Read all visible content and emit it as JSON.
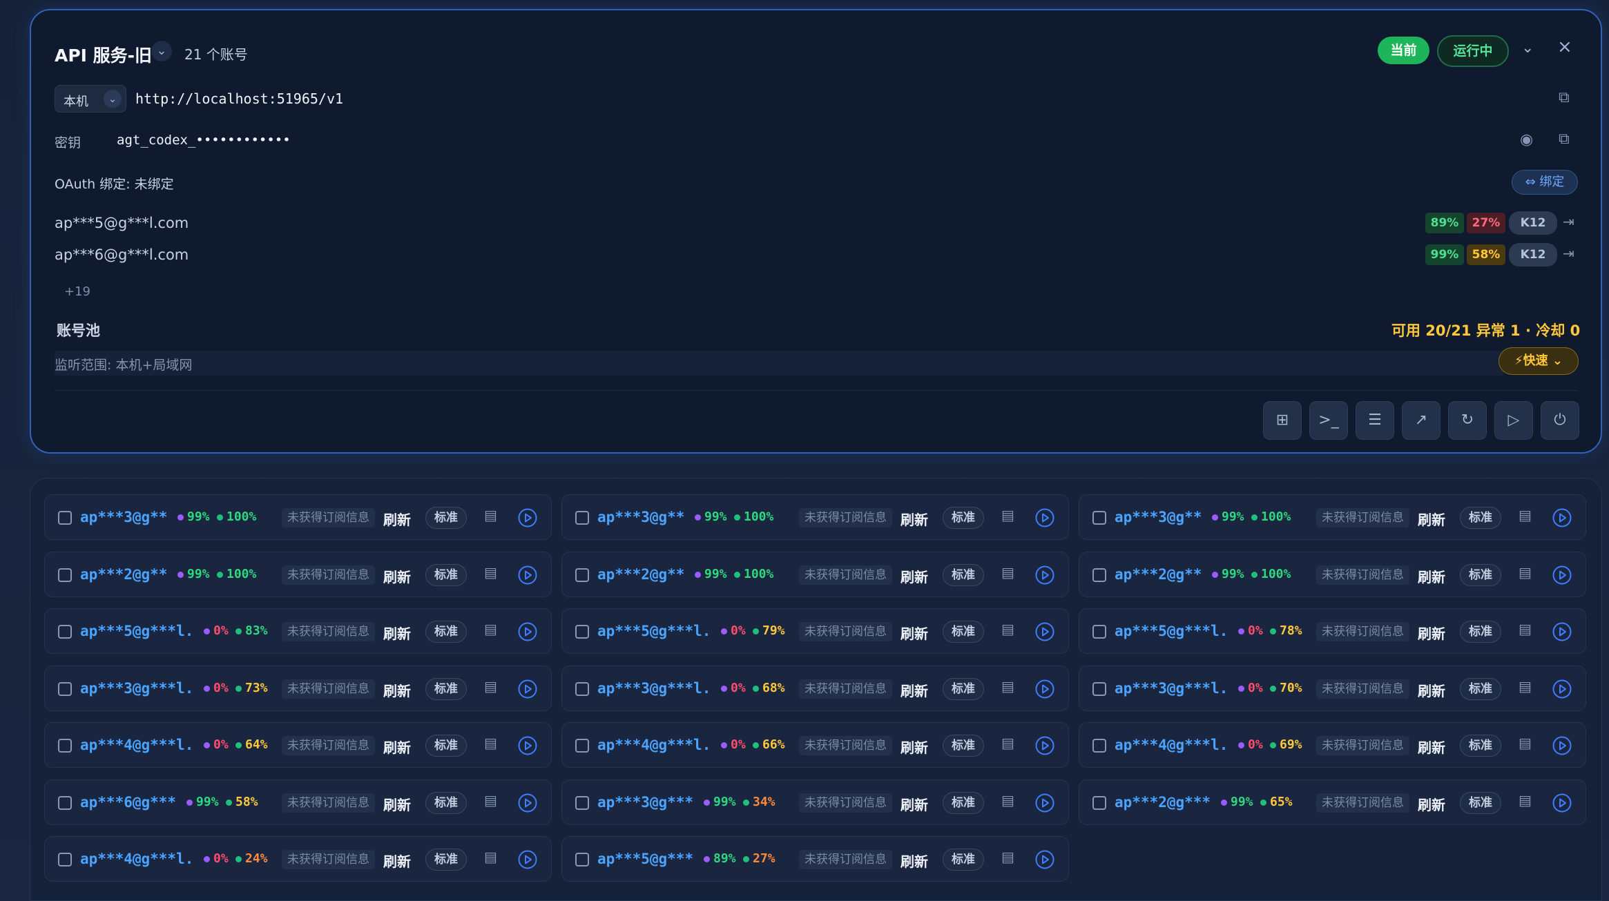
{
  "header": {
    "title": "API 服务-旧",
    "account_count": "21 个账号",
    "current_label": "当前",
    "running_label": "运行中"
  },
  "endpoint": {
    "host": "本机",
    "url": "http://localhost:51965/v1"
  },
  "key": {
    "label": "密钥",
    "value": "agt_codex_••••••••••••"
  },
  "oauth": {
    "text": "OAuth 绑定: 未绑定",
    "bind_label": "⇔ 绑定"
  },
  "bound_accounts": [
    {
      "email": "ap***5@g***l.com",
      "p1": "89%",
      "p2": "27%",
      "tag": "K12"
    },
    {
      "email": "ap***6@g***l.com",
      "p1": "99%",
      "p2": "58%",
      "tag": "K12"
    }
  ],
  "more_label": "+19",
  "pool": {
    "label": "账号池",
    "stats": "可用 20/21  异常 1 · 冷却 0",
    "listen_label": "监听范围: 本机+局域网",
    "fast_label": "⚡快速 ⌄"
  },
  "toolbar": [
    "folder-plus-icon",
    "terminal-icon",
    "database-icon",
    "external-link-icon",
    "refresh-icon",
    "play-icon",
    "power-icon"
  ],
  "colors": {
    "accent_blue": "#4aa3ff",
    "green": "#2fd87f",
    "red": "#ff4d6d",
    "amber": "#ffc83a",
    "orange": "#ff8a3a",
    "purple": "#9b5cff"
  },
  "row_labels": {
    "subscription": "未获得订阅信息",
    "refresh": "刷新",
    "standard": "标准"
  },
  "accounts": [
    {
      "name": "ap***3@g**",
      "p1": "99%",
      "p2": "100%",
      "c1": "green",
      "c2": "green"
    },
    {
      "name": "ap***3@g**",
      "p1": "99%",
      "p2": "100%",
      "c1": "green",
      "c2": "green"
    },
    {
      "name": "ap***3@g**",
      "p1": "99%",
      "p2": "100%",
      "c1": "green",
      "c2": "green"
    },
    {
      "name": "ap***2@g**",
      "p1": "99%",
      "p2": "100%",
      "c1": "green",
      "c2": "green"
    },
    {
      "name": "ap***2@g**",
      "p1": "99%",
      "p2": "100%",
      "c1": "green",
      "c2": "green"
    },
    {
      "name": "ap***2@g**",
      "p1": "99%",
      "p2": "100%",
      "c1": "green",
      "c2": "green"
    },
    {
      "name": "ap***5@g***l.",
      "p1": "0%",
      "p2": "83%",
      "c1": "red",
      "c2": "green"
    },
    {
      "name": "ap***5@g***l.",
      "p1": "0%",
      "p2": "79%",
      "c1": "red",
      "c2": "amber"
    },
    {
      "name": "ap***5@g***l.",
      "p1": "0%",
      "p2": "78%",
      "c1": "red",
      "c2": "amber"
    },
    {
      "name": "ap***3@g***l.",
      "p1": "0%",
      "p2": "73%",
      "c1": "red",
      "c2": "amber"
    },
    {
      "name": "ap***3@g***l.",
      "p1": "0%",
      "p2": "68%",
      "c1": "red",
      "c2": "amber"
    },
    {
      "name": "ap***3@g***l.",
      "p1": "0%",
      "p2": "70%",
      "c1": "red",
      "c2": "amber"
    },
    {
      "name": "ap***4@g***l.",
      "p1": "0%",
      "p2": "64%",
      "c1": "red",
      "c2": "amber"
    },
    {
      "name": "ap***4@g***l.",
      "p1": "0%",
      "p2": "66%",
      "c1": "red",
      "c2": "amber"
    },
    {
      "name": "ap***4@g***l.",
      "p1": "0%",
      "p2": "69%",
      "c1": "red",
      "c2": "amber"
    },
    {
      "name": "ap***6@g***",
      "p1": "99%",
      "p2": "58%",
      "c1": "green",
      "c2": "amber"
    },
    {
      "name": "ap***3@g***",
      "p1": "99%",
      "p2": "34%",
      "c1": "green",
      "c2": "orange"
    },
    {
      "name": "ap***2@g***",
      "p1": "99%",
      "p2": "65%",
      "c1": "green",
      "c2": "amber"
    },
    {
      "name": "ap***4@g***l.",
      "p1": "0%",
      "p2": "24%",
      "c1": "red",
      "c2": "orange"
    },
    {
      "name": "ap***5@g***",
      "p1": "89%",
      "p2": "27%",
      "c1": "green",
      "c2": "orange"
    }
  ]
}
